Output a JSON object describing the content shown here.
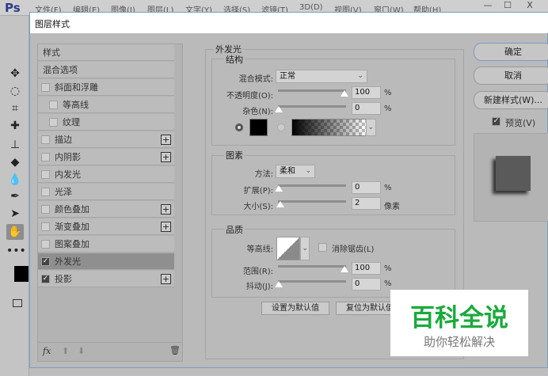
{
  "app": {
    "logo": "Ps",
    "menu": [
      "文件(F)",
      "编辑(E)",
      "图像(I)",
      "图层(L)",
      "文字(Y)",
      "选择(S)",
      "滤镜(T)",
      "3D(D)",
      "视图(V)",
      "窗口(W)",
      "帮助(H)"
    ],
    "window_buttons": [
      "—",
      "☐",
      "X"
    ]
  },
  "dialog": {
    "title": "图层样式"
  },
  "styles": {
    "header": "样式",
    "blend": "混合选项",
    "items": [
      {
        "label": "斜面和浮雕",
        "checked": false,
        "plus": false
      },
      {
        "label": "等高线",
        "checked": false,
        "plus": false,
        "indent": true
      },
      {
        "label": "纹理",
        "checked": false,
        "plus": false,
        "indent": true
      },
      {
        "label": "描边",
        "checked": false,
        "plus": true
      },
      {
        "label": "内阴影",
        "checked": false,
        "plus": true
      },
      {
        "label": "内发光",
        "checked": false,
        "plus": false
      },
      {
        "label": "光泽",
        "checked": false,
        "plus": false
      },
      {
        "label": "颜色叠加",
        "checked": false,
        "plus": true
      },
      {
        "label": "渐变叠加",
        "checked": false,
        "plus": true
      },
      {
        "label": "图案叠加",
        "checked": false,
        "plus": false
      },
      {
        "label": "外发光",
        "checked": true,
        "plus": false,
        "selected": true
      },
      {
        "label": "投影",
        "checked": true,
        "plus": true
      }
    ],
    "fx": "fx"
  },
  "outer_glow": {
    "title": "外发光",
    "structure": {
      "title": "结构",
      "blend_mode_label": "混合模式:",
      "blend_mode": "正常",
      "opacity_label": "不透明度(O):",
      "opacity": "100",
      "noise_label": "杂色(N):",
      "noise": "0",
      "pct": "%"
    },
    "elements": {
      "title": "图素",
      "method_label": "方法:",
      "method": "柔和",
      "spread_label": "扩展(P):",
      "spread": "0",
      "size_label": "大小(S):",
      "size": "2",
      "pct": "%",
      "px": "像素"
    },
    "quality": {
      "title": "品质",
      "contour_label": "等高线:",
      "antialias_label": "消除锯齿(L)",
      "range_label": "范围(R):",
      "range": "100",
      "jitter_label": "抖动(J):",
      "jitter": "0",
      "pct": "%"
    },
    "set_default": "设置为默认值",
    "reset_default": "复位为默认值"
  },
  "right": {
    "ok": "确定",
    "cancel": "取消",
    "new_style": "新建样式(W)...",
    "preview": "预览(V)"
  },
  "watermark": {
    "title": "百科全说",
    "subtitle": "助你轻松解决",
    "color": "#1aaa3c"
  }
}
